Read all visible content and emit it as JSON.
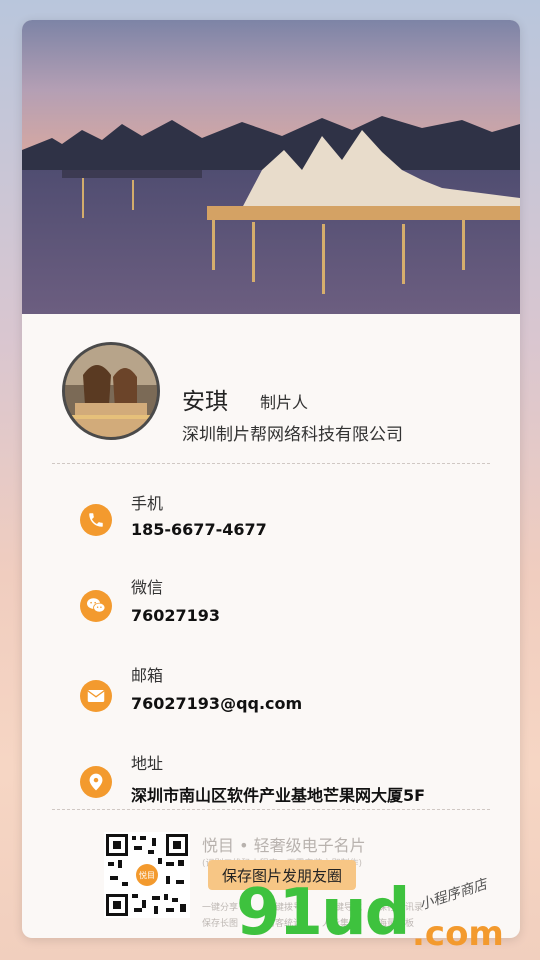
{
  "profile": {
    "name": "安琪",
    "title": "制片人",
    "company": "深圳制片帮网络科技有限公司"
  },
  "contacts": [
    {
      "label": "手机",
      "value": "185-6677-4677",
      "icon": "phone-icon"
    },
    {
      "label": "微信",
      "value": "76027193",
      "icon": "wechat-icon"
    },
    {
      "label": "邮箱",
      "value": "76027193@qq.com",
      "icon": "mail-icon"
    },
    {
      "label": "地址",
      "value": "深圳市南山区软件产业基地芒果网大厦5F",
      "icon": "location-icon"
    }
  ],
  "footer": {
    "qr_badge": "悦目",
    "brand": "悦目 • 轻奢级电子名片",
    "brand_sub": "(识别二维码小程序，无需安装立即制作)",
    "save_button": "保存图片发朋友圈",
    "features": [
      "一键分享",
      "一键拨号",
      "一键导航",
      "保存通讯录",
      "保存长图",
      "访客统计",
      "人脉集市",
      "海量模板"
    ]
  },
  "watermark": {
    "main": "91ud",
    "suffix": ".com",
    "tag": "小程序商店"
  },
  "colors": {
    "accent": "#f39a2e",
    "button": "#f7c685"
  }
}
